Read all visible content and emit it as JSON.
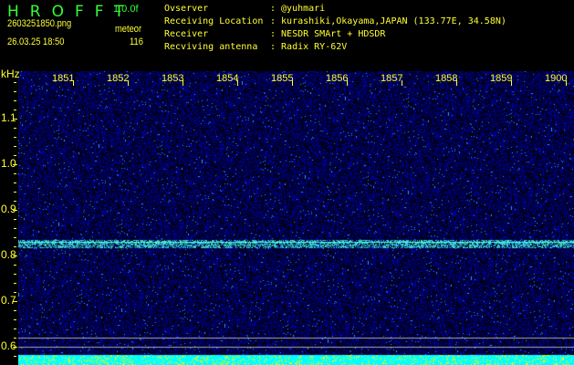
{
  "header": {
    "app_title": "HROFFT",
    "version": "1.0.0f",
    "filename": "2603251850.png",
    "datetime": "26.03.25 18:50",
    "mode": "meteor",
    "count": "116"
  },
  "info": [
    {
      "label": "Ovserver",
      "value": ": @yuhmari"
    },
    {
      "label": "Receiving Location",
      "value": ": kurashiki,Okayama,JAPAN (133.77E, 34.58N)"
    },
    {
      "label": "Receiver",
      "value": ": NESDR SMArt + HDSDR"
    },
    {
      "label": "Recviving antenna",
      "value": ": Radix RY-62V"
    }
  ],
  "axis": {
    "y_unit": "kHz",
    "y_ticks": [
      "1.1",
      "1.0",
      "0.9",
      "0.8",
      "0.7",
      "0.6"
    ],
    "x_ticks": [
      "1851",
      "1852",
      "1853",
      "1854",
      "1855",
      "1856",
      "1857",
      "1858",
      "1859",
      "1900"
    ]
  },
  "colors": {
    "title": "#33ff33",
    "text": "#ffff33",
    "signal": "#33ffcc",
    "background_noise": "#0000aa",
    "level_bar": "#00ffff"
  }
}
